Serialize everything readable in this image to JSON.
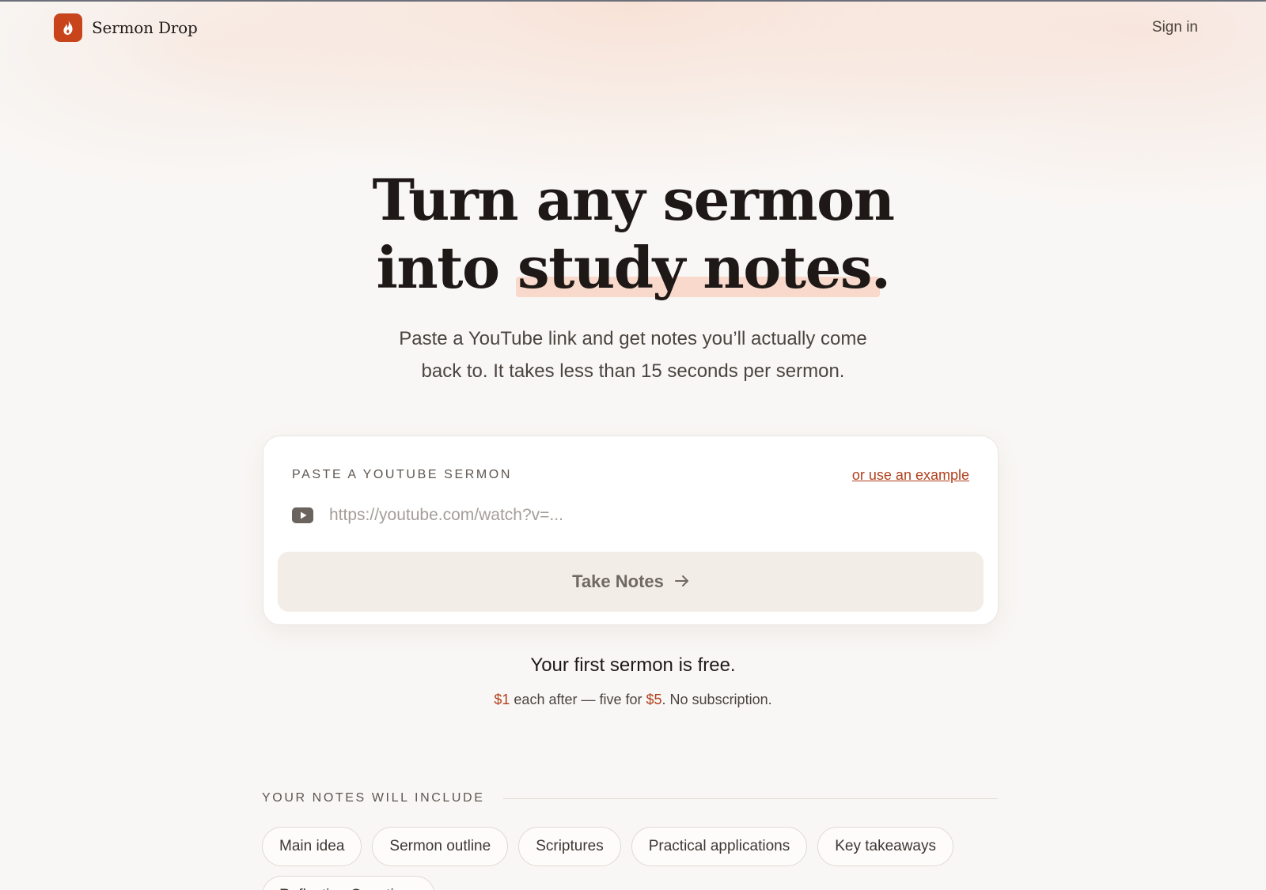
{
  "header": {
    "brand_name": "Sermon Drop",
    "sign_in_label": "Sign in"
  },
  "hero": {
    "title_line1": "Turn any sermon",
    "title_line2_prefix": "into ",
    "title_line2_highlight": "study notes",
    "title_line2_suffix": ".",
    "subtitle_line1": "Paste a YouTube link and get notes you’ll actually come",
    "subtitle_line2": "back to. It takes less than 15 seconds per sermon."
  },
  "form": {
    "label": "PASTE A YOUTUBE SERMON",
    "example_link": "or use an example",
    "url_value": "",
    "url_placeholder": "https://youtube.com/watch?v=...",
    "submit_label": "Take Notes"
  },
  "pricing": {
    "free_line": "Your first sermon is free.",
    "price_single": "$1",
    "mid_text": " each after — five for ",
    "price_bundle": "$5",
    "end_text": ". No subscription."
  },
  "includes": {
    "label": "YOUR NOTES WILL INCLUDE",
    "chips": [
      "Main idea",
      "Sermon outline",
      "Scriptures",
      "Practical applications",
      "Key takeaways",
      "Reflection Questions"
    ]
  },
  "colors": {
    "accent": "#c8451c",
    "link": "#b1401c",
    "highlight": "#f8d9cb",
    "background": "#f9f7f5"
  },
  "icons": {
    "logo": "flame-icon",
    "youtube": "youtube-icon",
    "arrow": "arrow-right-icon"
  }
}
